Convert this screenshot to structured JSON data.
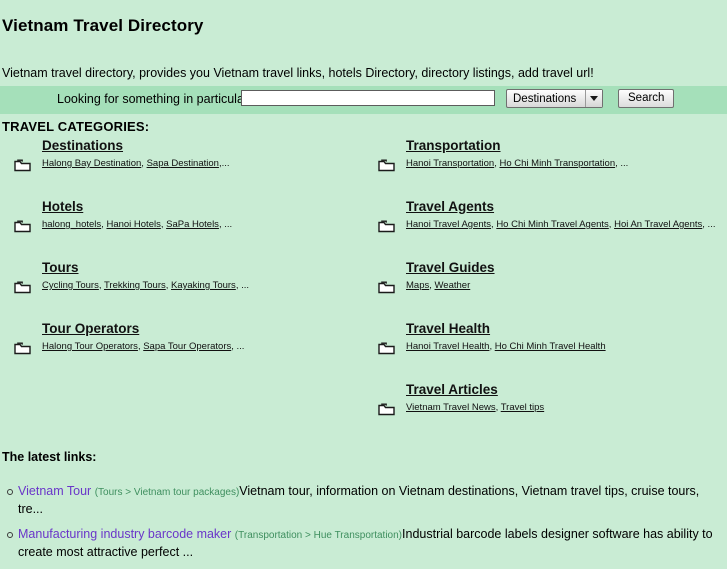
{
  "site": {
    "title": "Vietnam Travel Directory",
    "tagline": "Vietnam travel directory, provides you Vietnam travel links, hotels Directory, directory listings, add travel url!"
  },
  "search": {
    "label": "Looking for something in particular?",
    "input_value": "",
    "input_placeholder": "",
    "selected_option": "Destinations",
    "options": [
      "Destinations"
    ],
    "button_label": "Search",
    "band_color": "#a5e0ba"
  },
  "categories": {
    "heading": "TRAVEL CATEGORIES:",
    "left": [
      {
        "name": "Destinations",
        "icon": "folder-icon",
        "links": [
          "Halong Bay Destination",
          "Sapa Destination"
        ],
        "suffix": ",..."
      },
      {
        "name": "Hotels",
        "icon": "folder-icon",
        "links": [
          "halong_hotels",
          "Hanoi Hotels",
          "SaPa Hotels"
        ],
        "suffix": ", ..."
      },
      {
        "name": "Tours",
        "icon": "folder-icon",
        "links": [
          "Cycling Tours",
          "Trekking Tours",
          "Kayaking Tours"
        ],
        "suffix": ", ..."
      },
      {
        "name": "Tour Operators",
        "icon": "folder-icon",
        "links": [
          "Halong Tour Operators",
          "Sapa Tour Operators"
        ],
        "suffix": ", ..."
      }
    ],
    "right": [
      {
        "name": "Transportation",
        "icon": "folder-icon",
        "links": [
          "Hanoi Transportation",
          "Ho Chi Minh Transportation"
        ],
        "suffix": ", ..."
      },
      {
        "name": "Travel Agents",
        "icon": "folder-icon",
        "links": [
          "Hanoi Travel Agents",
          "Ho Chi Minh Travel Agents",
          "Hoi An Travel Agents"
        ],
        "suffix": ", ..."
      },
      {
        "name": "Travel Guides",
        "icon": "folder-icon",
        "links": [
          "Maps",
          "Weather"
        ],
        "suffix": ""
      },
      {
        "name": "Travel Health",
        "icon": "folder-icon",
        "links": [
          "Hanoi Travel Health",
          "Ho Chi Minh Travel Health"
        ],
        "suffix": ""
      },
      {
        "name": "Travel Articles",
        "icon": "folder-icon",
        "links": [
          "Vietnam Travel News",
          "Travel tips"
        ],
        "suffix": ""
      }
    ]
  },
  "latest": {
    "heading": "The latest links:",
    "items": [
      {
        "title": "Vietnam Tour",
        "path": "(Tours > Vietnam tour packages)",
        "description": "Vietnam tour, information on Vietnam destinations, Vietnam travel tips, cruise tours, tre..."
      },
      {
        "title": "Manufacturing industry barcode maker",
        "path": "(Transportation > Hue Transportation)",
        "description": "Industrial barcode labels designer software has ability to create most attractive perfect ..."
      }
    ]
  },
  "theme": {
    "page_background": "#c9ecd4",
    "search_band": "#a5e0ba",
    "link_purple": "#6a36c9",
    "path_green": "#3f8f5f"
  }
}
